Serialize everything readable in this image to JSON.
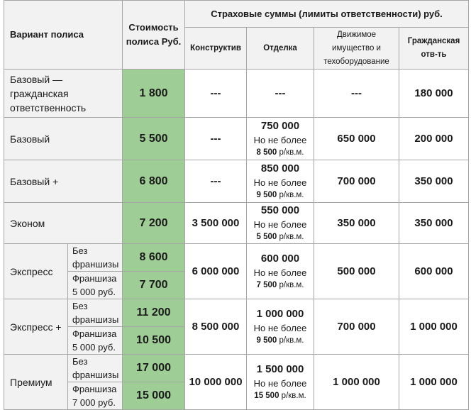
{
  "header": {
    "variant": "Вариант полиса",
    "price": "Стоимость полиса Руб.",
    "sums": "Страховые суммы (лимиты ответственности) руб.",
    "konstr": "Конструктив",
    "otdelka": "Отделка",
    "dvizh": "Движимое имущество и техоборудование",
    "grazhd": "Гражданская отв-ть"
  },
  "note": "Но не более",
  "unit": " р/кв.м.",
  "rows": [
    {
      "name": "Базовый — гражданская ответственность",
      "price": "1 800",
      "konstr": "---",
      "otdelka": "---",
      "dvizh": "---",
      "grazhd": "180 000"
    },
    {
      "name": "Базовый",
      "price": "5 500",
      "konstr": "---",
      "otdelka": "750 000",
      "rate": "8 500",
      "dvizh": "650 000",
      "grazhd": "200 000"
    },
    {
      "name": "Базовый +",
      "price": "6 800",
      "konstr": "---",
      "otdelka": "850 000",
      "rate": "9 500",
      "dvizh": "700 000",
      "grazhd": "350 000"
    },
    {
      "name": "Эконом",
      "price": "7 200",
      "konstr": "3 500 000",
      "otdelka": "550 000",
      "rate": "5 500",
      "dvizh": "350 000",
      "grazhd": "350 000"
    },
    {
      "name": "Экспресс",
      "sub1": "Без франшизы",
      "price1": "8 600",
      "sub2": "Франшиза 5 000 руб.",
      "price2": "7 700",
      "konstr": "6 000 000",
      "otdelka": "600 000",
      "rate": "7 500",
      "dvizh": "500 000",
      "grazhd": "600 000"
    },
    {
      "name": "Экспресс +",
      "sub1": "Без франшизы",
      "price1": "11 200",
      "sub2": "Франшиза 5 000 руб.",
      "price2": "10 500",
      "konstr": "8 500 000",
      "otdelka": "1 000 000",
      "rate": "9 500",
      "dvizh": "700 000",
      "grazhd": "1 000 000"
    },
    {
      "name": "Премиум",
      "sub1": "Без франшизы",
      "price1": "17 000",
      "sub2": "Франшиза 7 000 руб.",
      "price2": "15 000",
      "konstr": "10 000 000",
      "otdelka": "1 500 000",
      "rate": "15 500",
      "dvizh": "1 000 000",
      "grazhd": "1 000 000"
    }
  ]
}
